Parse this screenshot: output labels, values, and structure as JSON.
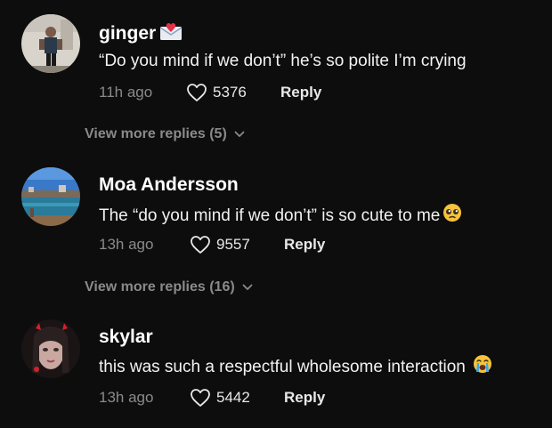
{
  "comments": [
    {
      "username": "ginger",
      "username_emoji": "envelope-heart-emoji",
      "text": "“Do you mind if we don’t” he’s so polite I’m crying",
      "time": "11h ago",
      "likes": "5376",
      "reply_label": "Reply",
      "view_more": "View more replies (5)"
    },
    {
      "username": "Moa Andersson",
      "text": "The “do you mind if we don’t” is so cute to me",
      "text_emoji": "pleading-face-emoji",
      "time": "13h ago",
      "likes": "9557",
      "reply_label": "Reply",
      "view_more": "View more replies (16)"
    },
    {
      "username": "skylar",
      "text": "this was such a respectful wholesome interaction",
      "text_emoji": "crying-face-emoji",
      "time": "13h ago",
      "likes": "5442",
      "reply_label": "Reply"
    }
  ],
  "colors": {
    "background": "#0d0d0d",
    "primary_text": "#ffffff",
    "secondary_text": "#8a8a8a"
  }
}
